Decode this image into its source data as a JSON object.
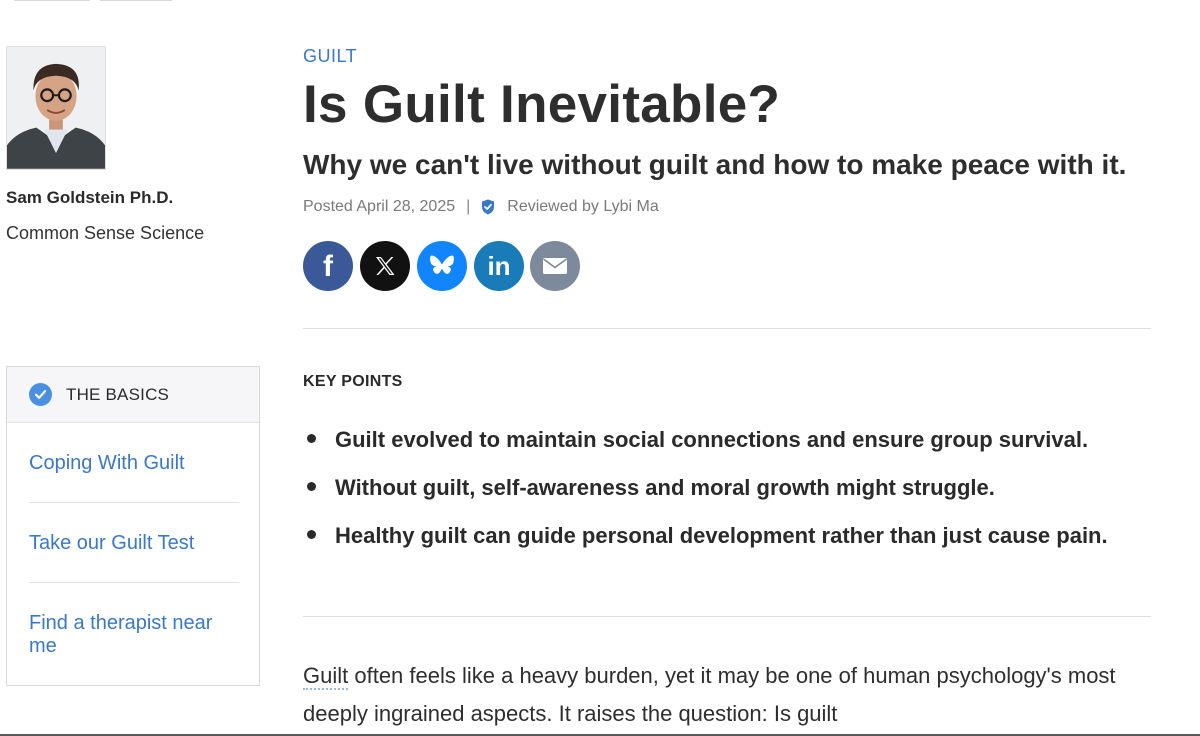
{
  "author": {
    "name": "Sam Goldstein Ph.D.",
    "blog": "Common Sense Science"
  },
  "basics": {
    "title": "THE BASICS",
    "links": [
      {
        "label": "Coping With Guilt"
      },
      {
        "label": "Take our Guilt Test"
      },
      {
        "label": "Find a therapist near me"
      }
    ]
  },
  "article": {
    "category": "GUILT",
    "title": "Is Guilt Inevitable?",
    "subtitle": "Why we can't live without guilt and how to make peace with it.",
    "posted": "Posted April 28, 2025",
    "separator": "|",
    "reviewed": "Reviewed by Lybi Ma",
    "key_points_title": "KEY POINTS",
    "key_points": [
      "Guilt evolved to maintain social connections and ensure group survival.",
      "Without guilt, self-awareness and moral growth might struggle.",
      "Healthy guilt can guide personal development rather than just cause pain."
    ],
    "body_term": "Guilt",
    "body_rest": " often feels like a heavy burden, yet it may be one of human psychology's most deeply ingrained aspects. It raises the question: Is guilt"
  },
  "share": [
    {
      "network": "facebook",
      "icon": "facebook-icon",
      "color": "#3b5998"
    },
    {
      "network": "x",
      "icon": "x-icon",
      "color": "#111111"
    },
    {
      "network": "bluesky",
      "icon": "bluesky-icon",
      "color": "#1185fe"
    },
    {
      "network": "linkedin",
      "icon": "linkedin-icon",
      "color": "#1a7bb9"
    },
    {
      "network": "email",
      "icon": "email-icon",
      "color": "#7d8a9b"
    }
  ],
  "colors": {
    "link": "#3a78c9",
    "accent": "#4a90e2"
  }
}
